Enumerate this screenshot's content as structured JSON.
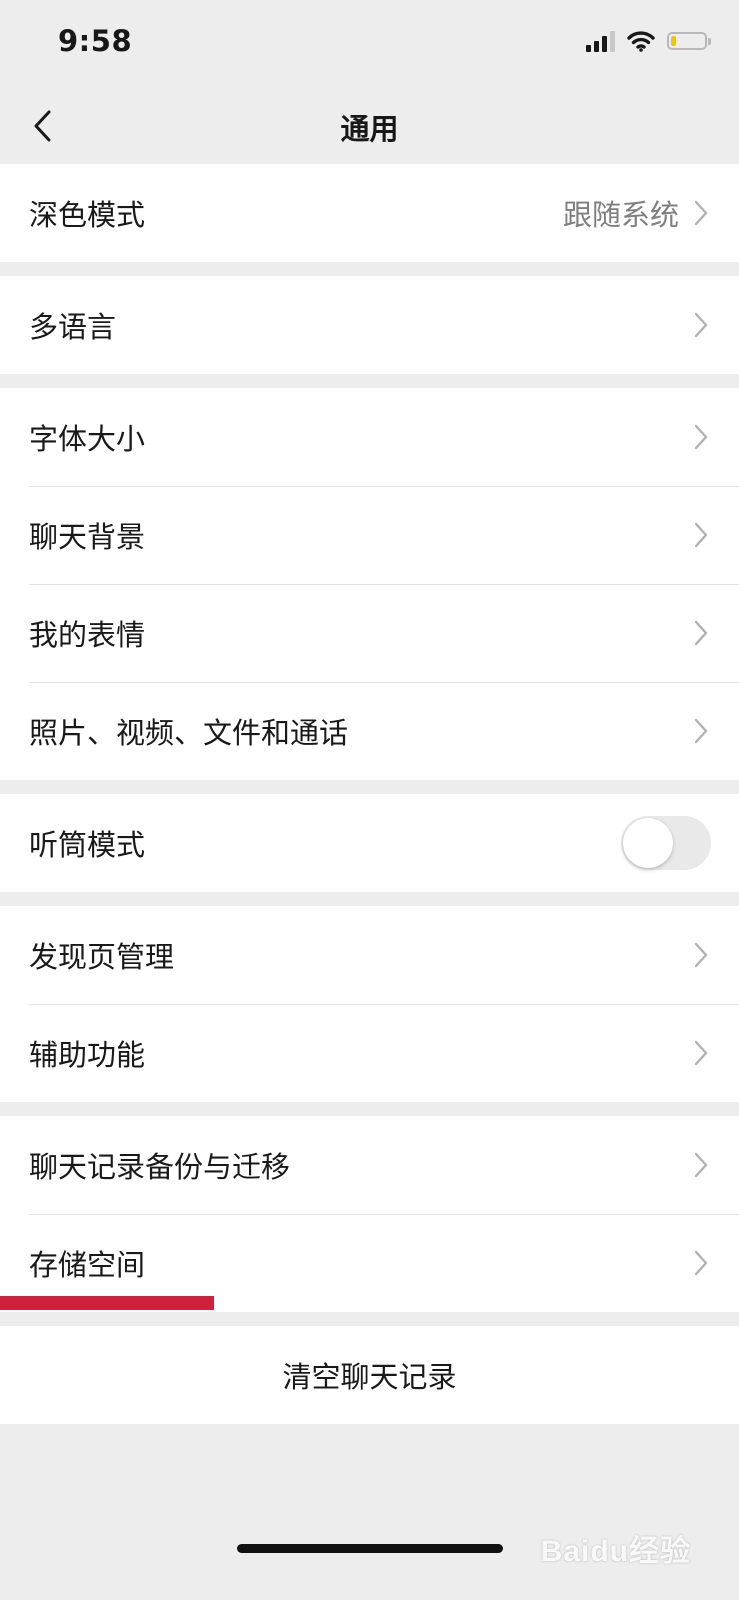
{
  "status_bar": {
    "time": "9:58",
    "battery_level": 0.15,
    "battery_color": "#f5c400"
  },
  "nav": {
    "title": "通用",
    "back_icon": "chevron-left-icon"
  },
  "groups": [
    {
      "rows": [
        {
          "label": "深色模式",
          "value": "跟随系统",
          "accessory": "chevron"
        }
      ]
    },
    {
      "rows": [
        {
          "label": "多语言",
          "accessory": "chevron"
        }
      ]
    },
    {
      "rows": [
        {
          "label": "字体大小",
          "accessory": "chevron"
        },
        {
          "label": "聊天背景",
          "accessory": "chevron"
        },
        {
          "label": "我的表情",
          "accessory": "chevron"
        },
        {
          "label": "照片、视频、文件和通话",
          "accessory": "chevron"
        }
      ]
    },
    {
      "rows": [
        {
          "label": "听筒模式",
          "accessory": "toggle",
          "toggle_on": false
        }
      ]
    },
    {
      "rows": [
        {
          "label": "发现页管理",
          "accessory": "chevron"
        },
        {
          "label": "辅助功能",
          "accessory": "chevron"
        }
      ]
    },
    {
      "rows": [
        {
          "label": "聊天记录备份与迁移",
          "accessory": "chevron"
        },
        {
          "label": "存储空间",
          "accessory": "chevron"
        }
      ]
    }
  ],
  "clear_button": {
    "label": "清空聊天记录"
  },
  "colors": {
    "background": "#ededed",
    "highlight": "#d0203a"
  },
  "watermark": "Baidu经验"
}
